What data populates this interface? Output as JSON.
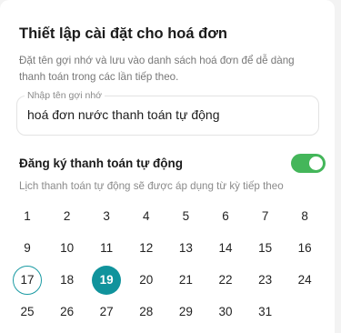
{
  "header": {
    "title": "Thiết lập cài đặt cho hoá đơn",
    "description": "Đặt tên gợi nhớ và lưu vào danh sách hoá đơn để dễ dàng thanh toán trong các lần tiếp theo."
  },
  "nickname_field": {
    "label": "Nhập tên gợi nhớ",
    "value": "hoá đơn nước thanh toán tự động"
  },
  "auto_pay": {
    "label": "Đăng ký thanh toán tự động",
    "enabled": true,
    "toggle_color": "#44b65a",
    "hint": "Lịch thanh toán tự động sẽ được áp dụng từ kỳ tiếp theo"
  },
  "calendar": {
    "days": [
      "1",
      "2",
      "3",
      "4",
      "5",
      "6",
      "7",
      "8",
      "9",
      "10",
      "11",
      "12",
      "13",
      "14",
      "15",
      "16",
      "17",
      "18",
      "19",
      "20",
      "21",
      "22",
      "23",
      "24",
      "25",
      "26",
      "27",
      "28",
      "29",
      "30",
      "31"
    ],
    "outlined_day": "17",
    "selected_day": "19",
    "accent_color": "#10939c"
  }
}
